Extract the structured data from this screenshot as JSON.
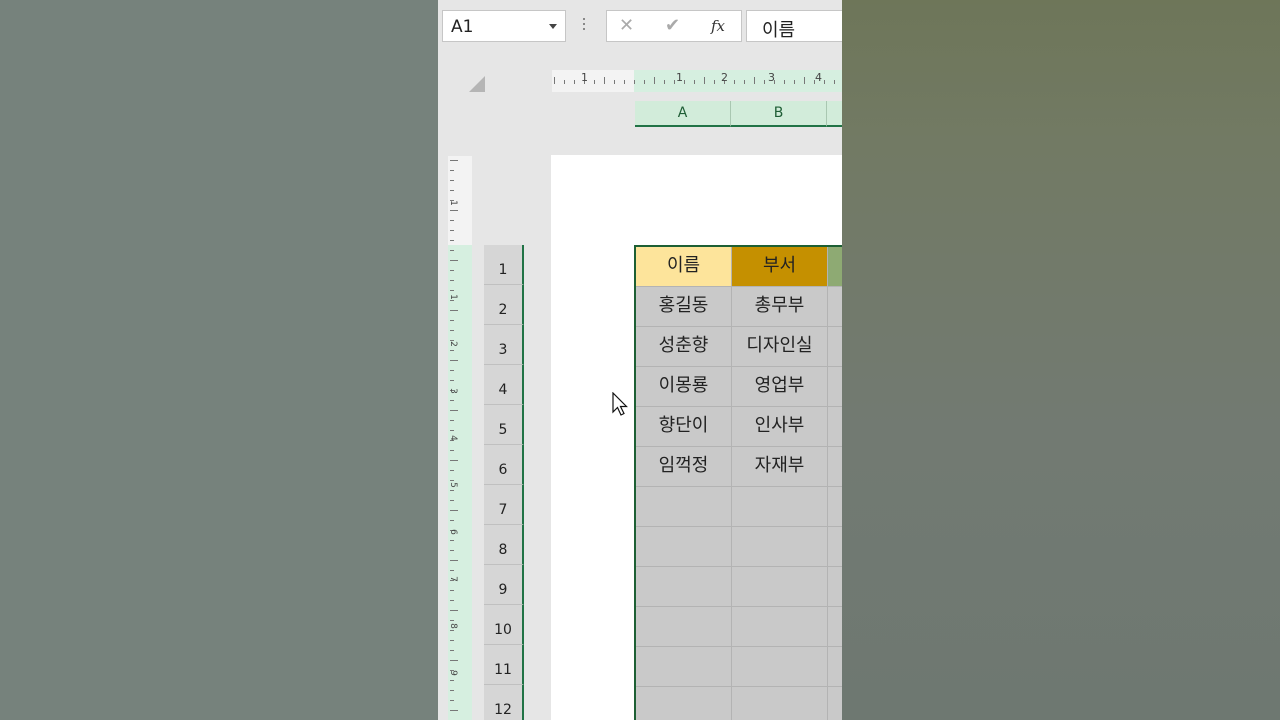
{
  "formula_bar": {
    "name_box": "A1",
    "cancel_icon": "✕",
    "enter_icon": "✔",
    "fx_label": "fx",
    "content": "이름"
  },
  "columns": [
    "A",
    "B"
  ],
  "rows": [
    "1",
    "2",
    "3",
    "4",
    "5",
    "6",
    "7",
    "8",
    "9",
    "10",
    "11",
    "12"
  ],
  "ruler": {
    "h_numbers": [
      "1",
      "1",
      "2",
      "3",
      "4"
    ],
    "v_numbers": [
      "1",
      "1",
      "2",
      "3",
      "4",
      "5",
      "6",
      "7",
      "8",
      "9"
    ]
  },
  "table": {
    "headers": [
      "이름",
      "부서"
    ],
    "rows": [
      [
        "홍길동",
        "총무부"
      ],
      [
        "성춘향",
        "디자인실"
      ],
      [
        "이몽룡",
        "영업부"
      ],
      [
        "향단이",
        "인사부"
      ],
      [
        "임꺽정",
        "자재부"
      ]
    ]
  },
  "colors": {
    "header_name_bg": "#fde49b",
    "header_dept_bg": "#c59000",
    "accent_green": "#217346"
  }
}
